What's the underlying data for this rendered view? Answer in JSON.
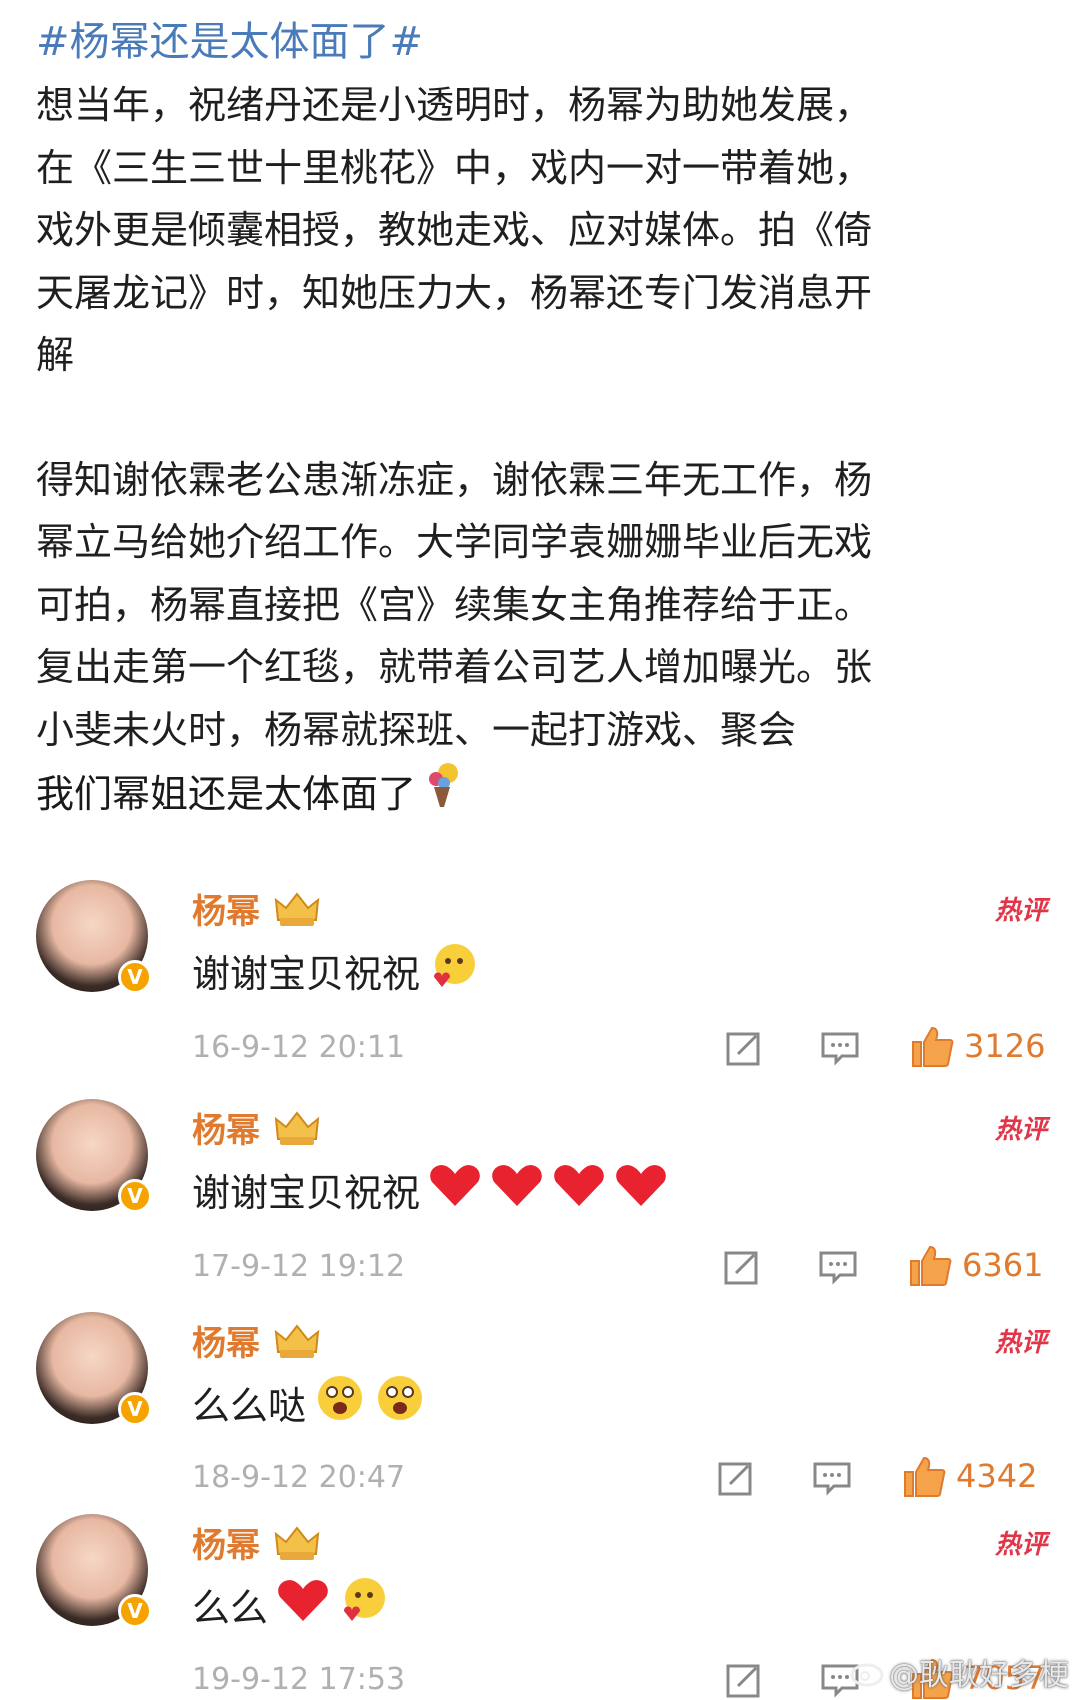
{
  "post": {
    "hashtag": "#杨幂还是太体面了#",
    "paragraph1": "想当年，祝绪丹还是小透明时，杨幂为助她发展，\n在《三生三世十里桃花》中，戏内一对一带着她，\n戏外更是倾囊相授，教她走戏、应对媒体。拍《倚\n天屠龙记》时，知她压力大，杨幂还专门发消息开\n解",
    "paragraph2": "得知谢依霖老公患渐冻症，谢依霖三年无工作，杨\n幂立马给她介绍工作。大学同学袁姗姗毕业后无戏\n可拍，杨幂直接把《宫》续集女主角推荐给于正。\n复出走第一个红毯，就带着公司艺人增加曝光。张\n小斐未火时，杨幂就探班、一起打游戏、聚会",
    "closing": "我们幂姐还是太体面了",
    "closing_emoji": "bouquet-icon"
  },
  "comments": [
    {
      "username": "杨幂",
      "hot_label": "热评",
      "text": "谢谢宝贝祝祝",
      "emojis": [
        "blush-heart-emoji"
      ],
      "time": "16-9-12 20:11",
      "likes": "3126"
    },
    {
      "username": "杨幂",
      "hot_label": "热评",
      "text": "谢谢宝贝祝祝",
      "emojis": [
        "heart-emoji",
        "heart-emoji",
        "heart-emoji",
        "heart-emoji"
      ],
      "time": "17-9-12 19:12",
      "likes": "6361"
    },
    {
      "username": "杨幂",
      "hot_label": "热评",
      "text": "么么哒",
      "emojis": [
        "excited-emoji",
        "excited-emoji"
      ],
      "time": "18-9-12 20:47",
      "likes": "4342"
    },
    {
      "username": "杨幂",
      "hot_label": "热评",
      "text": "么么",
      "emojis": [
        "heart-emoji",
        "blush-heart-emoji"
      ],
      "time": "19-9-12 17:53",
      "likes": "7057"
    }
  ],
  "watermark": "@耿耿好多梗",
  "colors": {
    "username": "#e07a2e",
    "hot": "#e0364a",
    "hashtag": "#4a7bb8",
    "likes": "#e07a2e",
    "time": "#b0b0b0"
  }
}
